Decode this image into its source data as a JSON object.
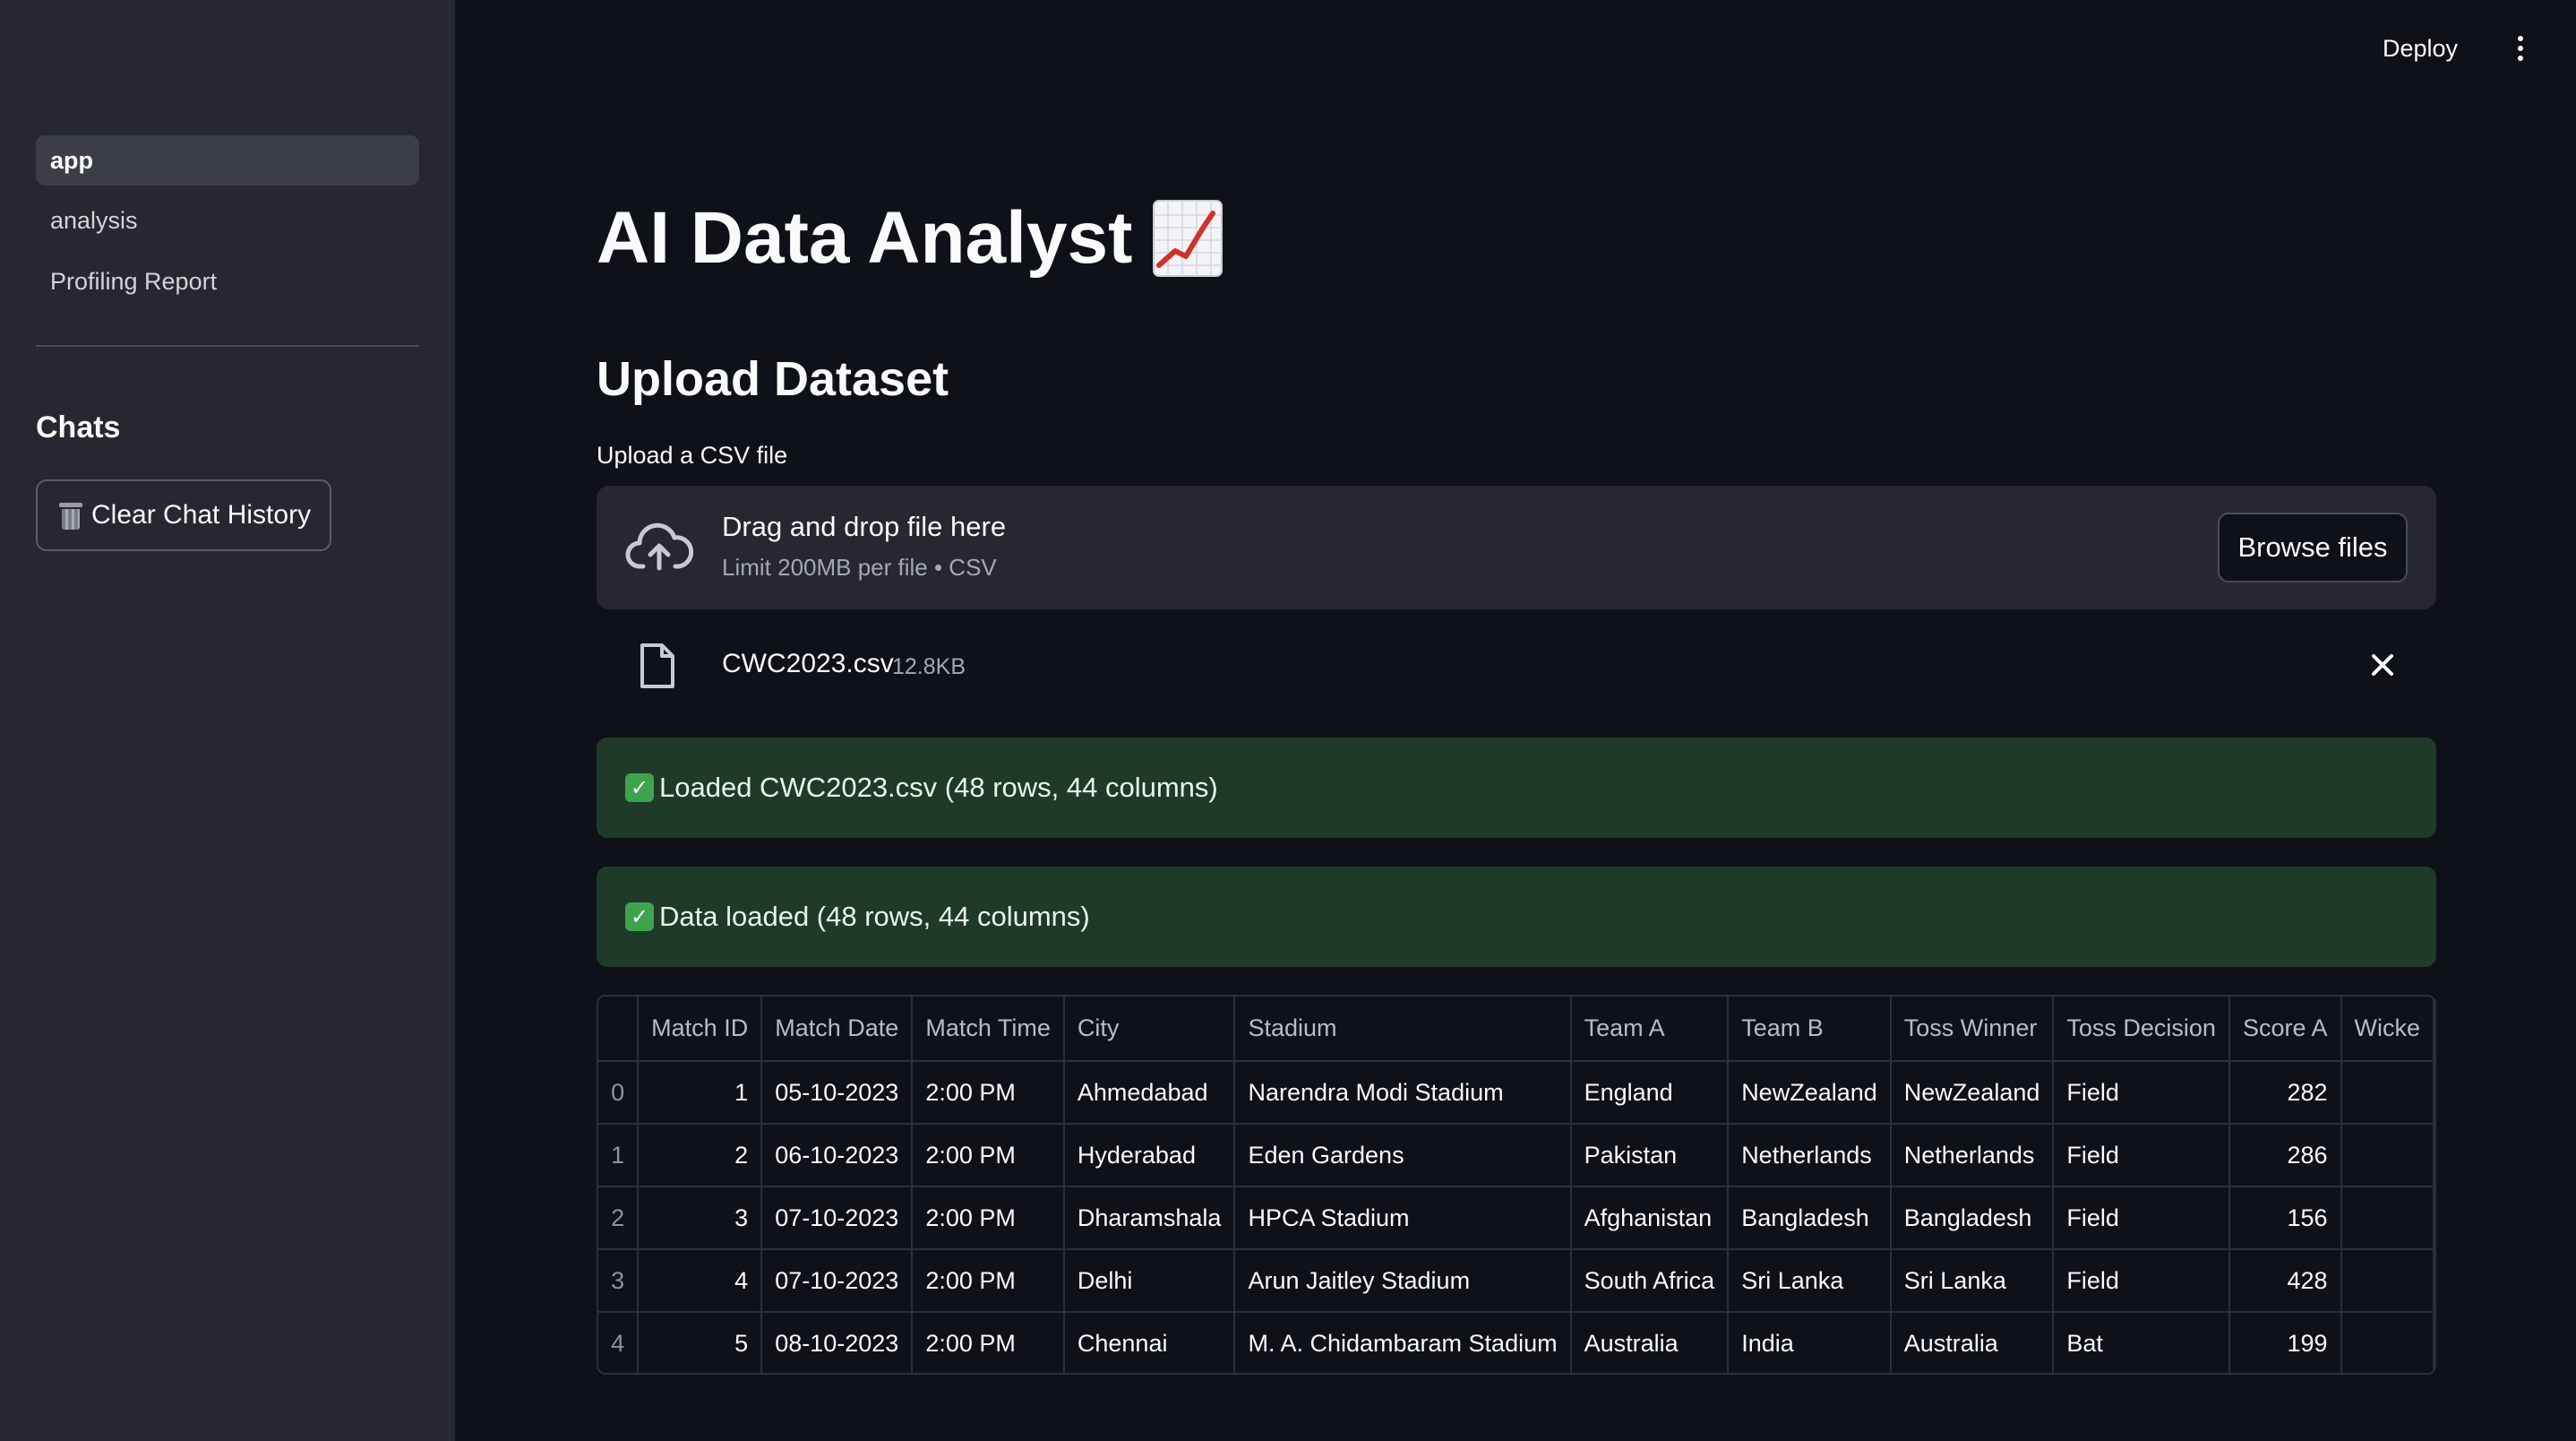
{
  "sidebar": {
    "nav": [
      {
        "label": "app",
        "active": true
      },
      {
        "label": "analysis",
        "active": false
      },
      {
        "label": "Profiling Report",
        "active": false
      }
    ],
    "chats_heading": "Chats",
    "clear_button_label": "Clear Chat History",
    "clear_button_icon": "trash-icon"
  },
  "header": {
    "deploy_label": "Deploy",
    "menu_icon": "kebab-menu-icon"
  },
  "main": {
    "title": "AI Data Analyst",
    "title_icon": "chart-increasing-icon",
    "subtitle": "Upload Dataset",
    "upload": {
      "label": "Upload a CSV file",
      "drop_title": "Drag and drop file here",
      "drop_limit": "Limit 200MB per file • CSV",
      "browse_label": "Browse files",
      "file": {
        "name": "CWC2023.csv",
        "size": "12.8KB"
      }
    },
    "alerts": [
      {
        "text": "Loaded CWC2023.csv (48 rows, 44 columns)"
      },
      {
        "text": "Data loaded (48 rows, 44 columns)"
      }
    ],
    "colors": {
      "success_bg": "#1f3a29",
      "check": "#3fa34d",
      "sidebar_bg": "#262730",
      "page_bg": "#0e1117"
    },
    "table": {
      "columns": [
        "",
        "Match ID",
        "Match Date",
        "Match Time",
        "City",
        "Stadium",
        "Team A",
        "Team B",
        "Toss Winner",
        "Toss Decision",
        "Score A",
        "Wicke"
      ],
      "rows": [
        [
          "0",
          "1",
          "05-10-2023",
          "2:00 PM",
          "Ahmedabad",
          "Narendra Modi Stadium",
          "England",
          "NewZealand",
          "NewZealand",
          "Field",
          "282",
          ""
        ],
        [
          "1",
          "2",
          "06-10-2023",
          "2:00 PM",
          "Hyderabad",
          "Eden Gardens",
          "Pakistan",
          "Netherlands",
          "Netherlands",
          "Field",
          "286",
          ""
        ],
        [
          "2",
          "3",
          "07-10-2023",
          "2:00 PM",
          "Dharamshala",
          "HPCA Stadium",
          "Afghanistan",
          "Bangladesh",
          "Bangladesh",
          "Field",
          "156",
          ""
        ],
        [
          "3",
          "4",
          "07-10-2023",
          "2:00 PM",
          "Delhi",
          "Arun Jaitley Stadium",
          "South Africa",
          "Sri Lanka",
          "Sri Lanka",
          "Field",
          "428",
          ""
        ],
        [
          "4",
          "5",
          "08-10-2023",
          "2:00 PM",
          "Chennai",
          "M. A. Chidambaram Stadium",
          "Australia",
          "India",
          "Australia",
          "Bat",
          "199",
          ""
        ]
      ]
    }
  }
}
